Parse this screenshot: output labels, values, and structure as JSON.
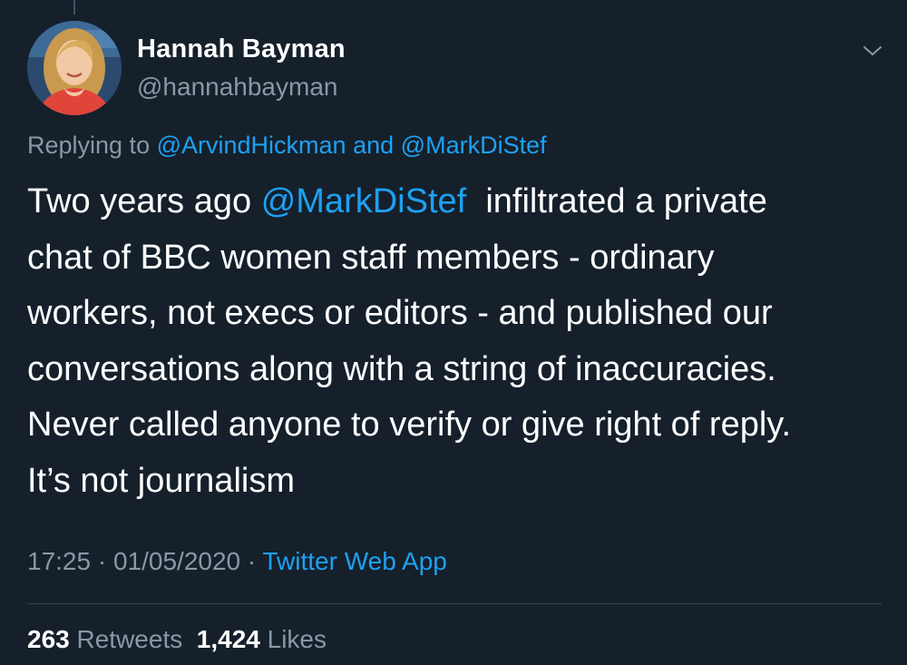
{
  "colors": {
    "background": "#15202b",
    "primary_text": "#ffffff",
    "secondary_text": "#8899a6",
    "link": "#1da1f2",
    "divider": "#38444d"
  },
  "icons": {
    "avatar": "avatar-photo",
    "menu": "chevron-down-icon"
  },
  "author": {
    "name": "Hannah Bayman",
    "handle": "@hannahbayman"
  },
  "reply": {
    "prefix": "Replying to",
    "mention_1": "@ArvindHickman",
    "conjunction": "and",
    "mention_2": "@MarkDiStef"
  },
  "tweet": {
    "line1_before": "Two years ago",
    "line1_mention": "@MarkDiStef",
    "line1_after": "infiltrated a private",
    "line2": "chat of BBC women staff members - ordinary",
    "line3": "workers, not execs or editors - and published our",
    "line4": "conversations along with a string of inaccuracies.",
    "line5": "Never called anyone to verify or give right of reply.",
    "line6": "It’s not journalism"
  },
  "meta": {
    "time": "17:25",
    "date": "01/05/2020",
    "source": "Twitter Web App"
  },
  "stats": {
    "retweets_count": "263",
    "retweets_label": "Retweets",
    "likes_count": "1,424",
    "likes_label": "Likes"
  }
}
